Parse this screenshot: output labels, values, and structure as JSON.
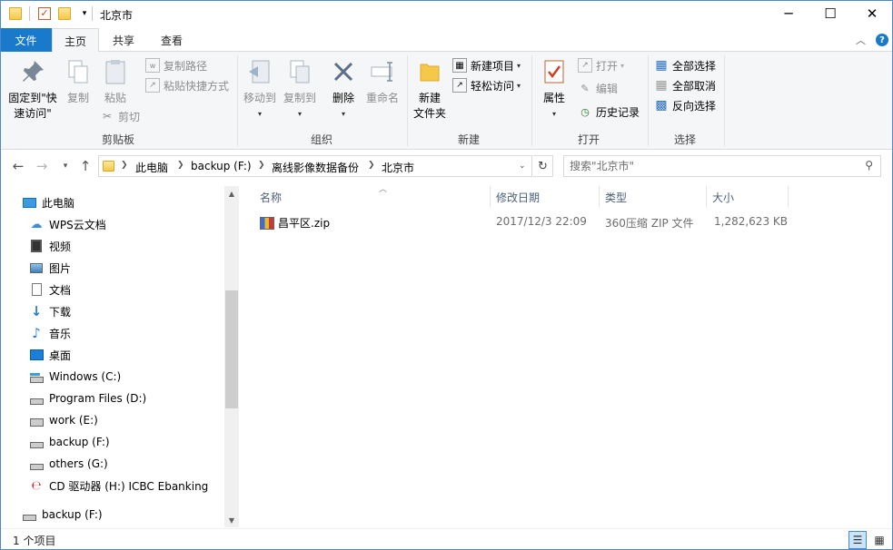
{
  "window": {
    "title": "北京市",
    "minimize_glyph": "─",
    "maximize_glyph": "☐",
    "close_glyph": "✕"
  },
  "tabs": {
    "file": "文件",
    "home": "主页",
    "share": "共享",
    "view": "查看",
    "collapse_glyph": "︿",
    "help_glyph": "?"
  },
  "ribbon": {
    "clipboard": {
      "group_label": "剪贴板",
      "pin_label_1": "固定到\"快",
      "pin_label_2": "速访问\"",
      "copy": "复制",
      "paste": "粘贴",
      "copy_path": "复制路径",
      "paste_shortcut": "粘贴快捷方式",
      "cut": "剪切"
    },
    "organize": {
      "group_label": "组织",
      "move_to": "移动到",
      "copy_to": "复制到",
      "delete": "删除",
      "rename": "重命名"
    },
    "new": {
      "group_label": "新建",
      "new_folder_1": "新建",
      "new_folder_2": "文件夹",
      "new_item": "新建项目",
      "easy_access": "轻松访问"
    },
    "open": {
      "group_label": "打开",
      "properties": "属性",
      "open": "打开",
      "edit": "编辑",
      "history": "历史记录"
    },
    "select": {
      "group_label": "选择",
      "select_all": "全部选择",
      "select_none": "全部取消",
      "invert": "反向选择"
    }
  },
  "address": {
    "crumbs": [
      "此电脑",
      "backup (F:)",
      "离线影像数据备份",
      "北京市"
    ],
    "search_placeholder": "搜索\"北京市\""
  },
  "nav": {
    "items": [
      {
        "label": "此电脑",
        "icon": "pc-icon"
      },
      {
        "label": "WPS云文档",
        "icon": "cloud-icon"
      },
      {
        "label": "视频",
        "icon": "video-icon"
      },
      {
        "label": "图片",
        "icon": "pictures-icon"
      },
      {
        "label": "文档",
        "icon": "documents-icon"
      },
      {
        "label": "下载",
        "icon": "download-icon"
      },
      {
        "label": "音乐",
        "icon": "music-icon"
      },
      {
        "label": "桌面",
        "icon": "desktop-icon"
      },
      {
        "label": "Windows (C:)",
        "icon": "system-drive-icon"
      },
      {
        "label": "Program Files (D:)",
        "icon": "drive-icon"
      },
      {
        "label": "work (E:)",
        "icon": "network-drive-icon"
      },
      {
        "label": "backup (F:)",
        "icon": "drive-icon"
      },
      {
        "label": "others (G:)",
        "icon": "drive-icon"
      },
      {
        "label": "CD 驱动器 (H:) ICBC Ebanking",
        "icon": "cd-drive-icon"
      },
      {
        "label": "backup (F:)",
        "icon": "drive-icon"
      }
    ]
  },
  "filelist": {
    "columns": [
      "名称",
      "修改日期",
      "类型",
      "大小"
    ],
    "rows": [
      {
        "name": "昌平区.zip",
        "modified": "2017/12/3 22:09",
        "type": "360压缩 ZIP 文件",
        "size": "1,282,623 KB"
      }
    ]
  },
  "status": {
    "item_count": "1 个项目"
  },
  "colors": {
    "accent": "#1979ca",
    "ribbon_bg": "#f5f6f7",
    "header_text": "#4c607a",
    "folder": "#f5c84a"
  }
}
